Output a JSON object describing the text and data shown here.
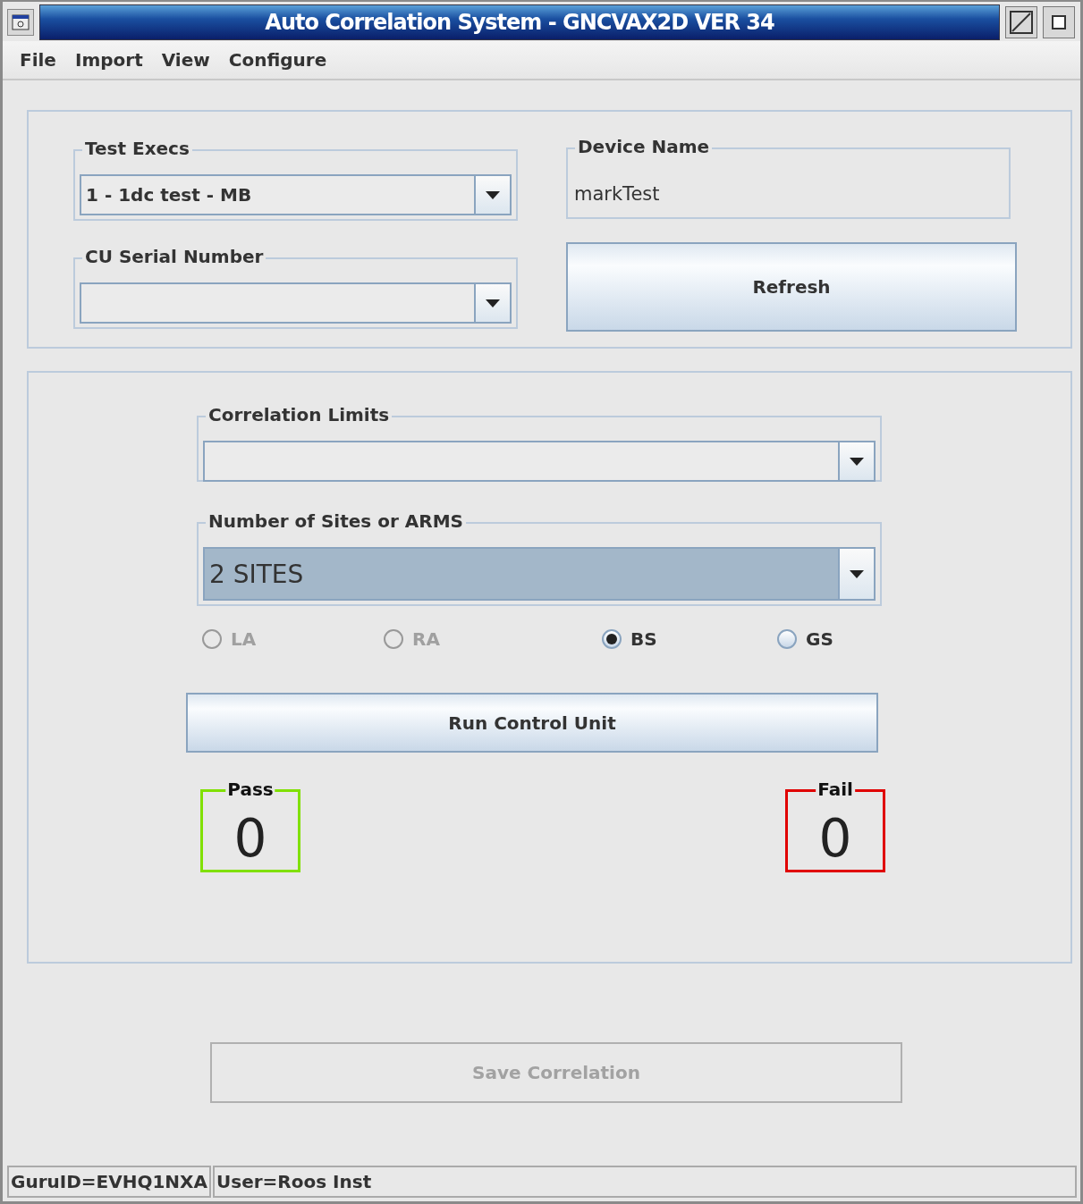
{
  "window": {
    "title": "Auto Correlation System - GNCVAX2D VER 34"
  },
  "menu": [
    {
      "label": "File"
    },
    {
      "label": "Import"
    },
    {
      "label": "View"
    },
    {
      "label": "Configure"
    }
  ],
  "test_execs": {
    "label": "Test Execs",
    "value": "1 - 1dc test - MB"
  },
  "device_name": {
    "label": "Device Name",
    "value": "markTest"
  },
  "cu_serial_number": {
    "label": "CU Serial Number"
  },
  "refresh_button": {
    "label": "Refresh"
  },
  "correlation_limits": {
    "label": "Correlation Limits"
  },
  "sites": {
    "label": "Number of Sites or ARMS",
    "value": "2 SITES"
  },
  "radios": [
    {
      "label": "LA",
      "selected": false,
      "disabled": true
    },
    {
      "label": "RA",
      "selected": false,
      "disabled": true
    },
    {
      "label": "BS",
      "selected": true,
      "disabled": false
    },
    {
      "label": "GS",
      "selected": false,
      "disabled": false
    }
  ],
  "run_button": {
    "label": "Run Control Unit"
  },
  "counters": [
    {
      "label": "Pass",
      "value": "0",
      "color": "#80e000"
    },
    {
      "label": "Fail",
      "value": "0",
      "color": "#e00000"
    }
  ],
  "save_button": {
    "label": "Save Correlation",
    "disabled": true
  },
  "status_bar": [
    {
      "text": "GuruID=EVHQ1NXA"
    },
    {
      "text": "User=Roos Inst"
    }
  ]
}
